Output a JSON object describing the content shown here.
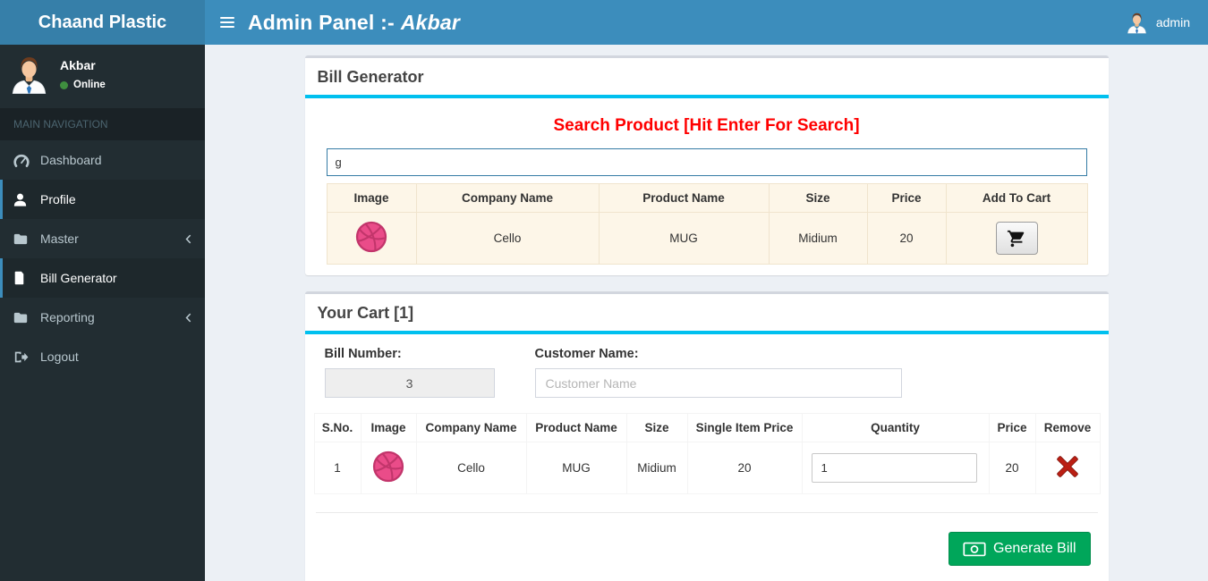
{
  "header": {
    "brand": "Chaand Plastic",
    "title_bold": "Admin Panel :-",
    "title_italic": "Akbar",
    "user": "admin"
  },
  "sidebar": {
    "user_name": "Akbar",
    "user_status": "Online",
    "nav_header": "MAIN NAVIGATION",
    "items": [
      {
        "label": "Dashboard"
      },
      {
        "label": "Profile"
      },
      {
        "label": "Master"
      },
      {
        "label": "Bill Generator"
      },
      {
        "label": "Reporting"
      },
      {
        "label": "Logout"
      }
    ]
  },
  "bill_generator": {
    "box_title": "Bill Generator",
    "search_heading": "Search Product [Hit Enter For Search]",
    "search_value": "g",
    "table": {
      "headers": [
        "Image",
        "Company Name",
        "Product Name",
        "Size",
        "Price",
        "Add To Cart"
      ],
      "row": {
        "company": "Cello",
        "product": "MUG",
        "size": "Midium",
        "price": "20"
      }
    }
  },
  "cart": {
    "box_title": "Your Cart [1]",
    "bill_number_label": "Bill Number:",
    "bill_number_value": "3",
    "customer_name_label": "Customer Name:",
    "customer_name_placeholder": "Customer Name",
    "table": {
      "headers": [
        "S.No.",
        "Image",
        "Company Name",
        "Product Name",
        "Size",
        "Single Item Price",
        "Quantity",
        "Price",
        "Remove"
      ],
      "row": {
        "sno": "1",
        "company": "Cello",
        "product": "MUG",
        "size": "Midium",
        "single_price": "20",
        "quantity": "1",
        "price": "20"
      }
    },
    "generate_button": "Generate Bill"
  },
  "colors": {
    "navbar_blue": "#3c8dbc",
    "logo_blue": "#367fa9",
    "sidebar_dark": "#222d32",
    "info_cyan": "#00c0ef",
    "success_green": "#00a65a",
    "heading_red": "#ff0000",
    "table_cream": "#fdf6e8",
    "product_pink": "#ea4c89"
  }
}
